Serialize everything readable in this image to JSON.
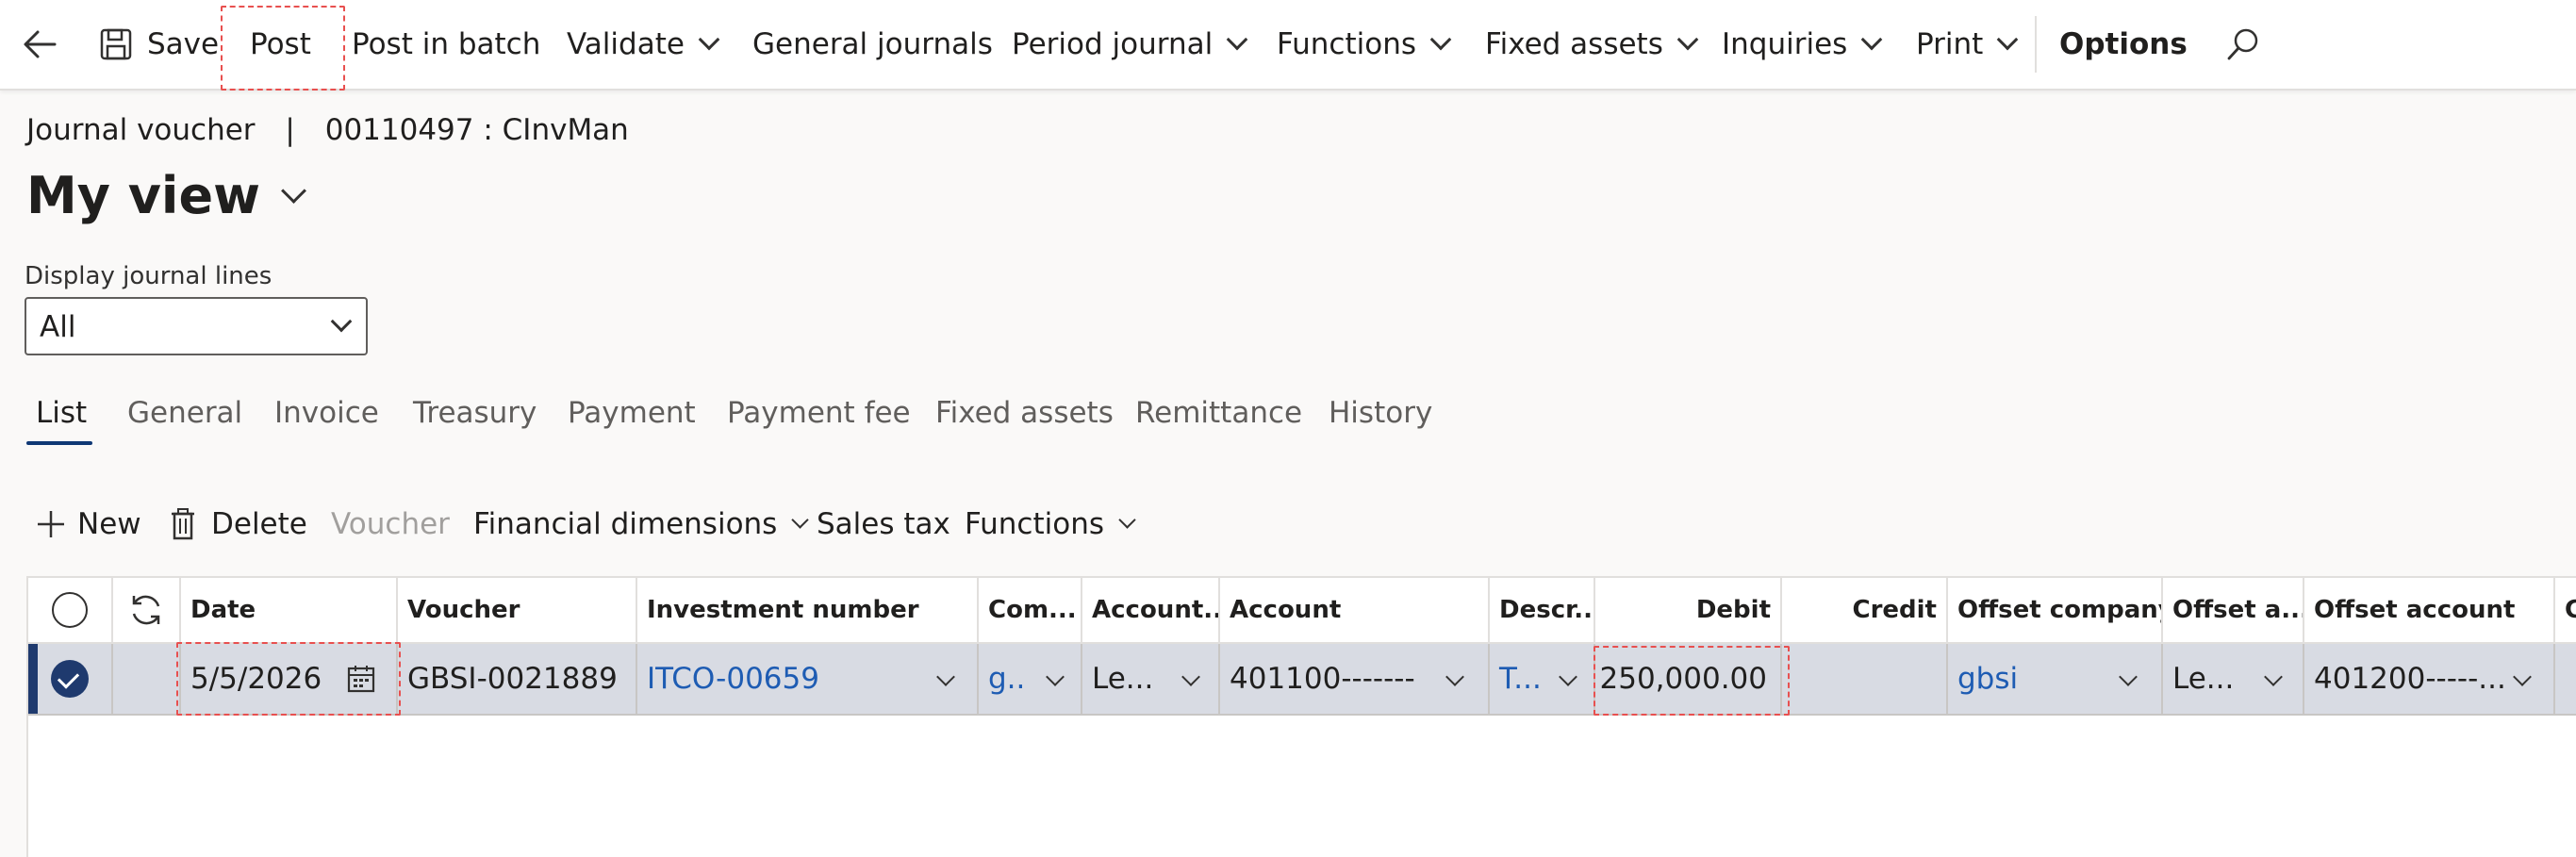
{
  "actionbar": {
    "save": "Save",
    "post": "Post",
    "post_in_batch": "Post in batch",
    "validate": "Validate",
    "general_journals": "General journals",
    "period_journal": "Period journal",
    "functions": "Functions",
    "fixed_assets": "Fixed assets",
    "inquiries": "Inquiries",
    "print": "Print",
    "options": "Options"
  },
  "breadcrumb": {
    "page": "Journal voucher",
    "separator": "|",
    "record": "00110497 : CInvMan"
  },
  "view": {
    "title": "My view"
  },
  "display_lines": {
    "label": "Display journal lines",
    "value": "All"
  },
  "tabs": [
    "List",
    "General",
    "Invoice",
    "Treasury",
    "Payment",
    "Payment fee",
    "Fixed assets",
    "Remittance",
    "History"
  ],
  "toolbar": {
    "new": "New",
    "delete": "Delete",
    "voucher": "Voucher",
    "financial_dimensions": "Financial dimensions",
    "sales_tax": "Sales tax",
    "functions": "Functions"
  },
  "grid": {
    "headers": [
      "Date",
      "Voucher",
      "Investment number",
      "Com...",
      "Account...",
      "Account",
      "Descr...",
      "Debit",
      "Credit",
      "Offset company",
      "Offset a...",
      "Offset account",
      "C"
    ],
    "row": {
      "date": "5/5/2026",
      "voucher": "GBSI-0021889",
      "investment_number": "ITCO-00659",
      "company": "g..",
      "account_type": "Le...",
      "account": "401100-------",
      "description": "T...",
      "debit": "250,000.00",
      "credit": "",
      "offset_company": "gbsi",
      "offset_account_type": "Le...",
      "offset_account": "401200-----..."
    }
  },
  "colors": {
    "accent": "#1f3a6e",
    "link": "#1e5cb3",
    "highlight": "#e8504f",
    "selected_row": "#d8dbe3"
  }
}
